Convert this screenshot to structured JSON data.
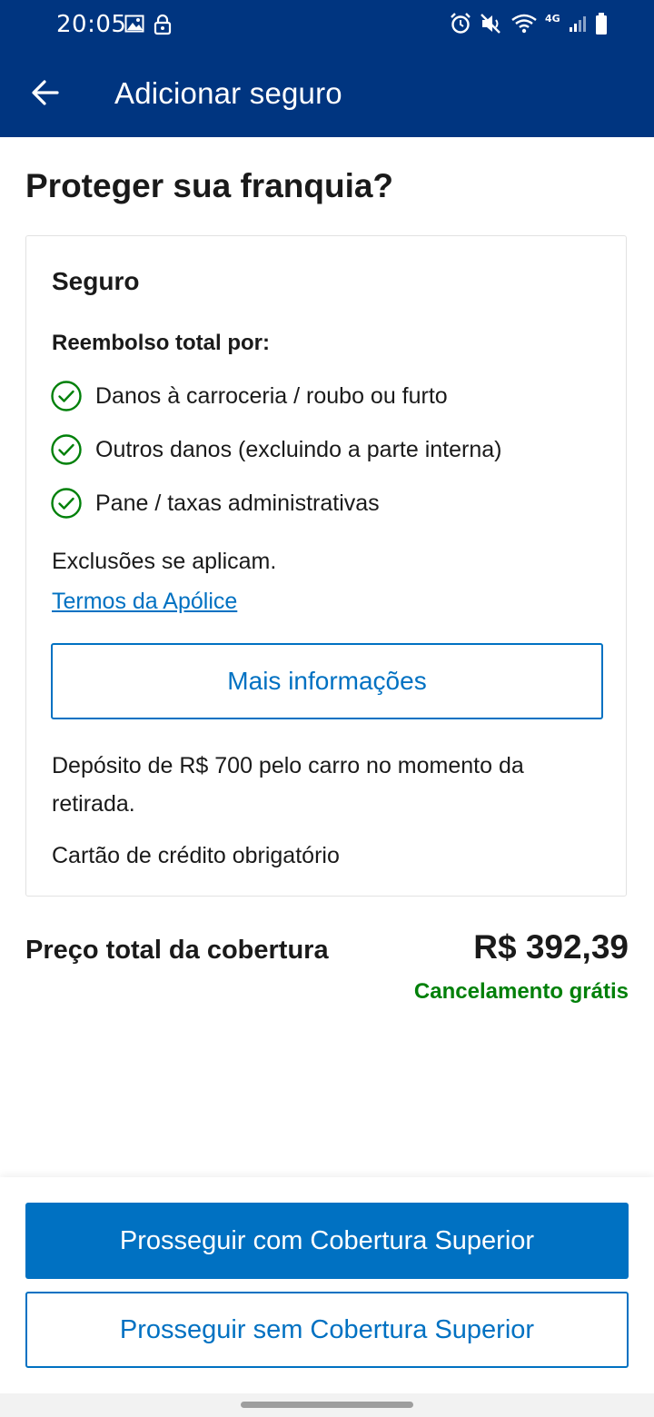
{
  "status_bar": {
    "time": "20:05",
    "network_label": "4G",
    "left_icons": [
      "image-icon",
      "lock-icon"
    ],
    "right_icons": [
      "alarm-icon",
      "mute-icon",
      "wifi-icon",
      "signal-icon",
      "battery-icon"
    ]
  },
  "app_bar": {
    "title": "Adicionar seguro",
    "back_icon": "arrow-left-icon"
  },
  "page": {
    "title": "Proteger sua franquia?"
  },
  "card": {
    "title": "Seguro",
    "subtitle": "Reembolso total por:",
    "benefits": [
      {
        "label": "Danos à carroceria / roubo ou furto",
        "icon": "check-circle-icon"
      },
      {
        "label": "Outros danos (excluindo a parte interna)",
        "icon": "check-circle-icon"
      },
      {
        "label": "Pane / taxas administrativas",
        "icon": "check-circle-icon"
      }
    ],
    "exclusions": "Exclusões se aplicam.",
    "terms_link": "Termos da Apólice",
    "more_info_button": "Mais informações",
    "deposit_text": "Depósito de R$ 700 pelo carro no momento da retirada.",
    "credit_card_text": "Cartão de crédito obrigatório"
  },
  "price": {
    "label": "Preço total da cobertura",
    "value": "R$ 392,39",
    "note": "Cancelamento grátis"
  },
  "footer": {
    "primary_button": "Prosseguir com Cobertura Superior",
    "secondary_button": "Prosseguir sem Cobertura Superior"
  },
  "colors": {
    "header_bg": "#003580",
    "accent_blue": "#0071c2",
    "success_green": "#008009",
    "text": "#1a1a1a"
  }
}
